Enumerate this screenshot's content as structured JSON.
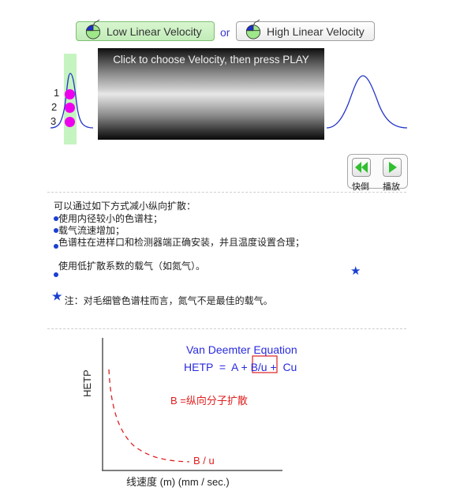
{
  "velocity_buttons": {
    "low_label": "Low Linear Velocity",
    "or_label": "or",
    "high_label": "High Linear Velocity",
    "selected": "low"
  },
  "column": {
    "message": "Click to choose Velocity, then press PLAY"
  },
  "peaks": [
    "1",
    "2",
    "3"
  ],
  "controls": {
    "rewind_label": "快倒",
    "play_label": "播放"
  },
  "text_block": {
    "intro": "可以通过如下方式减小纵向扩散：",
    "items": [
      "使用内径较小的色谱柱；",
      "载气流速增加；",
      "色谱柱在进样口和检测器端正确安装，并且温度设置合理；",
      "使用低扩散系数的载气（如氮气）。"
    ],
    "note_star": "*",
    "note": "注：对毛细管色谱柱而言，氮气不是最佳的载气。"
  },
  "graph": {
    "title": "Van Deemter Equation",
    "equation_left": "HETP  =  A + ",
    "equation_highlight": "B/u",
    "equation_right": " +  Cu",
    "b_definition": "B =纵向分子扩散",
    "curve_label": "B / u",
    "ylabel": "HETP",
    "xlabel": "线速度 (m) (mm / sec.)"
  },
  "colors": {
    "accent_blue": "#2a2ae0",
    "highlight_red": "#e02020",
    "selected_green": "#c2ecb9",
    "peak_magenta": "#ee00ee"
  }
}
